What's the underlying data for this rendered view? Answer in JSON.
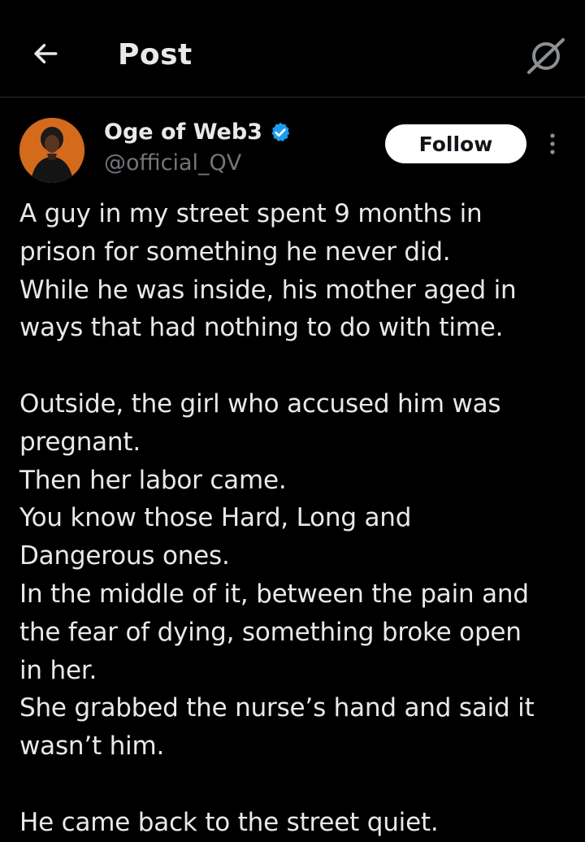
{
  "header": {
    "title": "Post",
    "back_icon": "arrow-left-icon",
    "grok_icon": "grok-icon"
  },
  "author": {
    "name": "Oge of Web3",
    "handle": "@official_QV",
    "verified": true,
    "verified_color": "#1d9bf0",
    "follow_label": "Follow",
    "more_icon": "more-vertical-icon"
  },
  "post": {
    "paragraphs": [
      [
        "A guy in my street spent 9 months in",
        "prison for something he never did.",
        "While he was inside, his mother aged in",
        "ways that had nothing to do with time."
      ],
      [
        "Outside, the girl who accused him was",
        "pregnant.",
        "Then her labor came.",
        "You know those Hard, Long and",
        "Dangerous ones.",
        "In the middle of it, between the pain and",
        "the fear of dying, something broke open",
        "in her.",
        "She grabbed the nurse’s hand and said it",
        "wasn’t him."
      ],
      [
        "He came back to the street quiet."
      ]
    ]
  },
  "colors": {
    "background": "#000000",
    "text": "#e7e9ea",
    "secondary_text": "#71767b",
    "divider": "#2f3336"
  }
}
